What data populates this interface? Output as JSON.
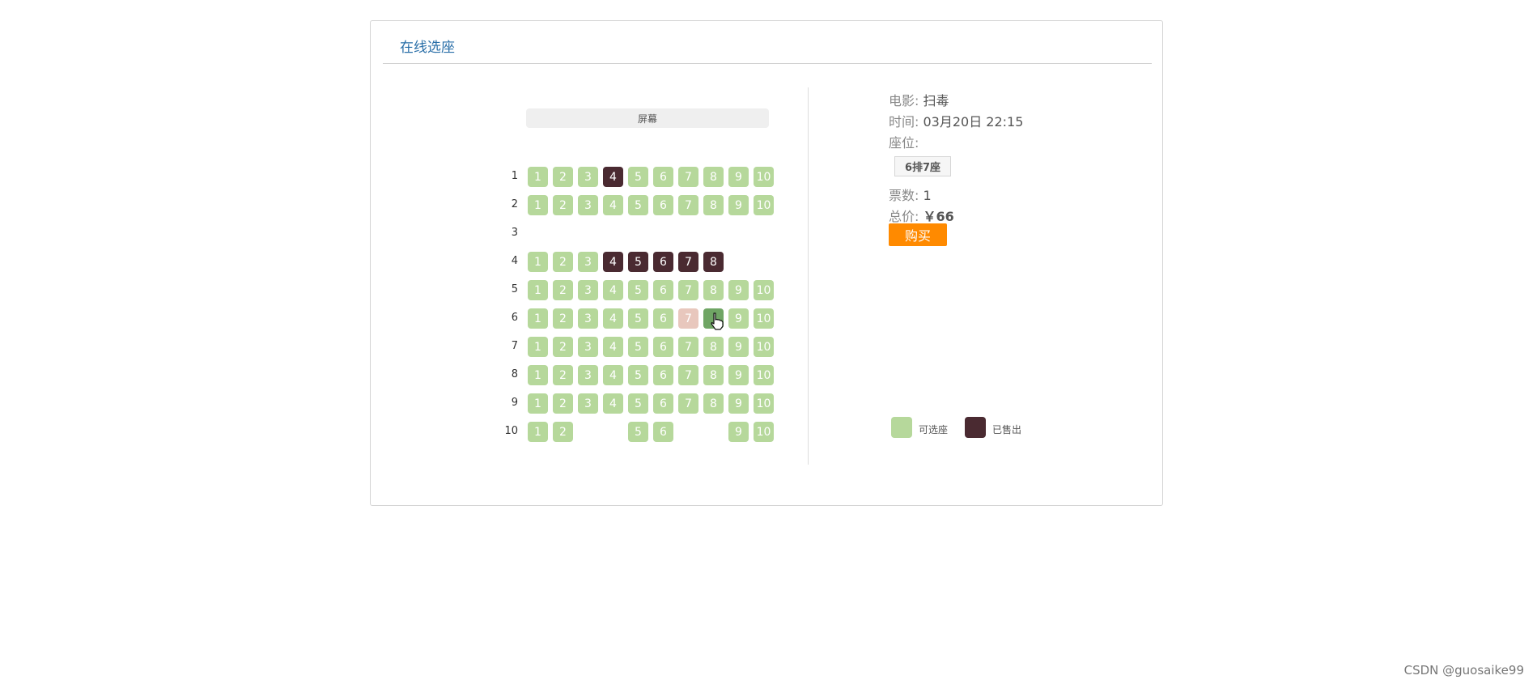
{
  "panel": {
    "title": "在线选座"
  },
  "seatmap": {
    "screen_label": "屏幕",
    "rows": [
      {
        "label": "1",
        "seats": [
          {
            "n": "1",
            "status": "available"
          },
          {
            "n": "2",
            "status": "available"
          },
          {
            "n": "3",
            "status": "available"
          },
          {
            "n": "4",
            "status": "sold"
          },
          {
            "n": "5",
            "status": "available"
          },
          {
            "n": "6",
            "status": "available"
          },
          {
            "n": "7",
            "status": "available"
          },
          {
            "n": "8",
            "status": "available"
          },
          {
            "n": "9",
            "status": "available"
          },
          {
            "n": "10",
            "status": "available"
          }
        ]
      },
      {
        "label": "2",
        "seats": [
          {
            "n": "1",
            "status": "available"
          },
          {
            "n": "2",
            "status": "available"
          },
          {
            "n": "3",
            "status": "available"
          },
          {
            "n": "4",
            "status": "available"
          },
          {
            "n": "5",
            "status": "available"
          },
          {
            "n": "6",
            "status": "available"
          },
          {
            "n": "7",
            "status": "available"
          },
          {
            "n": "8",
            "status": "available"
          },
          {
            "n": "9",
            "status": "available"
          },
          {
            "n": "10",
            "status": "available"
          }
        ]
      },
      {
        "label": "3",
        "seats": []
      },
      {
        "label": "4",
        "seats": [
          {
            "n": "1",
            "status": "available"
          },
          {
            "n": "2",
            "status": "available"
          },
          {
            "n": "3",
            "status": "available"
          },
          {
            "n": "4",
            "status": "sold"
          },
          {
            "n": "5",
            "status": "sold"
          },
          {
            "n": "6",
            "status": "sold"
          },
          {
            "n": "7",
            "status": "sold"
          },
          {
            "n": "8",
            "status": "sold"
          },
          null,
          null
        ]
      },
      {
        "label": "5",
        "seats": [
          {
            "n": "1",
            "status": "available"
          },
          {
            "n": "2",
            "status": "available"
          },
          {
            "n": "3",
            "status": "available"
          },
          {
            "n": "4",
            "status": "available"
          },
          {
            "n": "5",
            "status": "available"
          },
          {
            "n": "6",
            "status": "available"
          },
          {
            "n": "7",
            "status": "available"
          },
          {
            "n": "8",
            "status": "available"
          },
          {
            "n": "9",
            "status": "available"
          },
          {
            "n": "10",
            "status": "available"
          }
        ]
      },
      {
        "label": "6",
        "seats": [
          {
            "n": "1",
            "status": "available"
          },
          {
            "n": "2",
            "status": "available"
          },
          {
            "n": "3",
            "status": "available"
          },
          {
            "n": "4",
            "status": "available"
          },
          {
            "n": "5",
            "status": "available"
          },
          {
            "n": "6",
            "status": "available"
          },
          {
            "n": "7",
            "status": "selected"
          },
          {
            "n": "",
            "status": "hover"
          },
          {
            "n": "9",
            "status": "available"
          },
          {
            "n": "10",
            "status": "available"
          }
        ]
      },
      {
        "label": "7",
        "seats": [
          {
            "n": "1",
            "status": "available"
          },
          {
            "n": "2",
            "status": "available"
          },
          {
            "n": "3",
            "status": "available"
          },
          {
            "n": "4",
            "status": "available"
          },
          {
            "n": "5",
            "status": "available"
          },
          {
            "n": "6",
            "status": "available"
          },
          {
            "n": "7",
            "status": "available"
          },
          {
            "n": "8",
            "status": "available"
          },
          {
            "n": "9",
            "status": "available"
          },
          {
            "n": "10",
            "status": "available"
          }
        ]
      },
      {
        "label": "8",
        "seats": [
          {
            "n": "1",
            "status": "available"
          },
          {
            "n": "2",
            "status": "available"
          },
          {
            "n": "3",
            "status": "available"
          },
          {
            "n": "4",
            "status": "available"
          },
          {
            "n": "5",
            "status": "available"
          },
          {
            "n": "6",
            "status": "available"
          },
          {
            "n": "7",
            "status": "available"
          },
          {
            "n": "8",
            "status": "available"
          },
          {
            "n": "9",
            "status": "available"
          },
          {
            "n": "10",
            "status": "available"
          }
        ]
      },
      {
        "label": "9",
        "seats": [
          {
            "n": "1",
            "status": "available"
          },
          {
            "n": "2",
            "status": "available"
          },
          {
            "n": "3",
            "status": "available"
          },
          {
            "n": "4",
            "status": "available"
          },
          {
            "n": "5",
            "status": "available"
          },
          {
            "n": "6",
            "status": "available"
          },
          {
            "n": "7",
            "status": "available"
          },
          {
            "n": "8",
            "status": "available"
          },
          {
            "n": "9",
            "status": "available"
          },
          {
            "n": "10",
            "status": "available"
          }
        ]
      },
      {
        "label": "10",
        "seats": [
          {
            "n": "1",
            "status": "available"
          },
          {
            "n": "2",
            "status": "available"
          },
          null,
          null,
          {
            "n": "5",
            "status": "available"
          },
          {
            "n": "6",
            "status": "available"
          },
          null,
          null,
          {
            "n": "9",
            "status": "available"
          },
          {
            "n": "10",
            "status": "available"
          }
        ]
      }
    ]
  },
  "info": {
    "movie_label": "电影:",
    "movie_value": "扫毒",
    "time_label": "时间:",
    "time_value": "03月20日 22:15",
    "seat_label": "座位:",
    "selected_seat": "6排7座",
    "count_label": "票数:",
    "count_value": "1",
    "total_label": "总价:",
    "total_value": "￥66",
    "buy_label": "购买"
  },
  "legend": {
    "available_label": "可选座",
    "sold_label": "已售出"
  },
  "colors": {
    "available": "#b6d89b",
    "sold": "#4a2a31",
    "selected": "#e8c7bd",
    "hover": "#6fa564",
    "accent": "#ff8a00",
    "title": "#2a6fa8"
  },
  "watermark": "CSDN @guosaike99"
}
